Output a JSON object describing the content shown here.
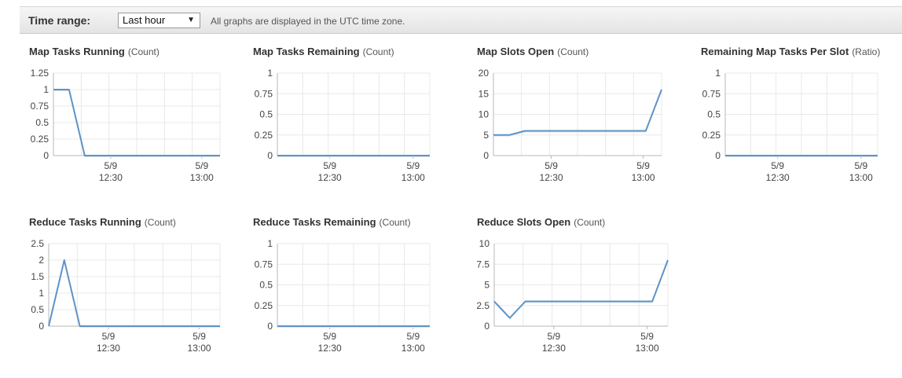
{
  "toolbar": {
    "time_range_label": "Time range:",
    "time_range_value": "Last hour",
    "timezone_note": "All graphs are displayed in the UTC time zone."
  },
  "colors": {
    "line": "#5f93c5",
    "fill": "#dce6f0",
    "grid": "#e8e8e8",
    "axis": "#b8b8b8"
  },
  "chart_data": [
    {
      "type": "line",
      "title": "Map Tasks Running",
      "unit": "(Count)",
      "yticks": [
        "1.25",
        "1",
        "0.75",
        "0.5",
        "0.25",
        "0"
      ],
      "ylim": [
        0,
        1.25
      ],
      "xlim": [
        0,
        64
      ],
      "xticks": [
        {
          "x": 22,
          "date": "5/9",
          "time": "12:30"
        },
        {
          "x": 57,
          "date": "5/9",
          "time": "13:00"
        }
      ],
      "series": [
        {
          "x": [
            0,
            6,
            12,
            64
          ],
          "values": [
            1,
            1,
            0,
            0
          ]
        }
      ]
    },
    {
      "type": "line",
      "title": "Map Tasks Remaining",
      "unit": "(Count)",
      "yticks": [
        "1",
        "0.75",
        "0.5",
        "0.25",
        "0"
      ],
      "ylim": [
        0,
        1
      ],
      "xlim": [
        0,
        64
      ],
      "xticks": [
        {
          "x": 22,
          "date": "5/9",
          "time": "12:30"
        },
        {
          "x": 57,
          "date": "5/9",
          "time": "13:00"
        }
      ],
      "series": [
        {
          "x": [
            0,
            64
          ],
          "values": [
            0,
            0
          ]
        }
      ]
    },
    {
      "type": "line",
      "title": "Map Slots Open",
      "unit": "(Count)",
      "yticks": [
        "20",
        "15",
        "10",
        "5",
        "0"
      ],
      "ylim": [
        0,
        20
      ],
      "xlim": [
        0,
        64
      ],
      "xticks": [
        {
          "x": 22,
          "date": "5/9",
          "time": "12:30"
        },
        {
          "x": 57,
          "date": "5/9",
          "time": "13:00"
        }
      ],
      "series": [
        {
          "x": [
            0,
            6,
            12,
            58,
            64
          ],
          "values": [
            5,
            5,
            6,
            6,
            16
          ]
        }
      ]
    },
    {
      "type": "line",
      "title": "Remaining Map Tasks Per Slot",
      "unit": "(Ratio)",
      "yticks": [
        "1",
        "0.75",
        "0.5",
        "0.25",
        "0"
      ],
      "ylim": [
        0,
        1
      ],
      "xlim": [
        0,
        64
      ],
      "xticks": [
        {
          "x": 22,
          "date": "5/9",
          "time": "12:30"
        },
        {
          "x": 57,
          "date": "5/9",
          "time": "13:00"
        }
      ],
      "series": [
        {
          "x": [
            0,
            64
          ],
          "values": [
            0,
            0
          ]
        }
      ]
    },
    {
      "type": "line",
      "title": "Reduce Tasks Running",
      "unit": "(Count)",
      "yticks": [
        "2.5",
        "2",
        "1.5",
        "1",
        "0.5",
        "0"
      ],
      "ylim": [
        0,
        2.5
      ],
      "xlim": [
        0,
        66
      ],
      "xticks": [
        {
          "x": 23,
          "date": "5/9",
          "time": "12:30"
        },
        {
          "x": 58,
          "date": "5/9",
          "time": "13:00"
        }
      ],
      "series": [
        {
          "x": [
            0,
            6,
            12,
            66
          ],
          "values": [
            0,
            2,
            0,
            0
          ]
        }
      ]
    },
    {
      "type": "line",
      "title": "Reduce Tasks Remaining",
      "unit": "(Count)",
      "yticks": [
        "1",
        "0.75",
        "0.5",
        "0.25",
        "0"
      ],
      "ylim": [
        0,
        1
      ],
      "xlim": [
        0,
        64
      ],
      "xticks": [
        {
          "x": 22,
          "date": "5/9",
          "time": "12:30"
        },
        {
          "x": 57,
          "date": "5/9",
          "time": "13:00"
        }
      ],
      "series": [
        {
          "x": [
            0,
            64
          ],
          "values": [
            0,
            0
          ]
        }
      ]
    },
    {
      "type": "line",
      "title": "Reduce Slots Open",
      "unit": "(Count)",
      "yticks": [
        "10",
        "7.5",
        "5",
        "2.5",
        "0"
      ],
      "ylim": [
        0,
        10
      ],
      "xlim": [
        0,
        67
      ],
      "xticks": [
        {
          "x": 23,
          "date": "5/9",
          "time": "12:30"
        },
        {
          "x": 59,
          "date": "5/9",
          "time": "13:00"
        }
      ],
      "series": [
        {
          "x": [
            0,
            6,
            12,
            61,
            67
          ],
          "values": [
            3,
            1,
            3,
            3,
            8
          ]
        }
      ]
    }
  ]
}
